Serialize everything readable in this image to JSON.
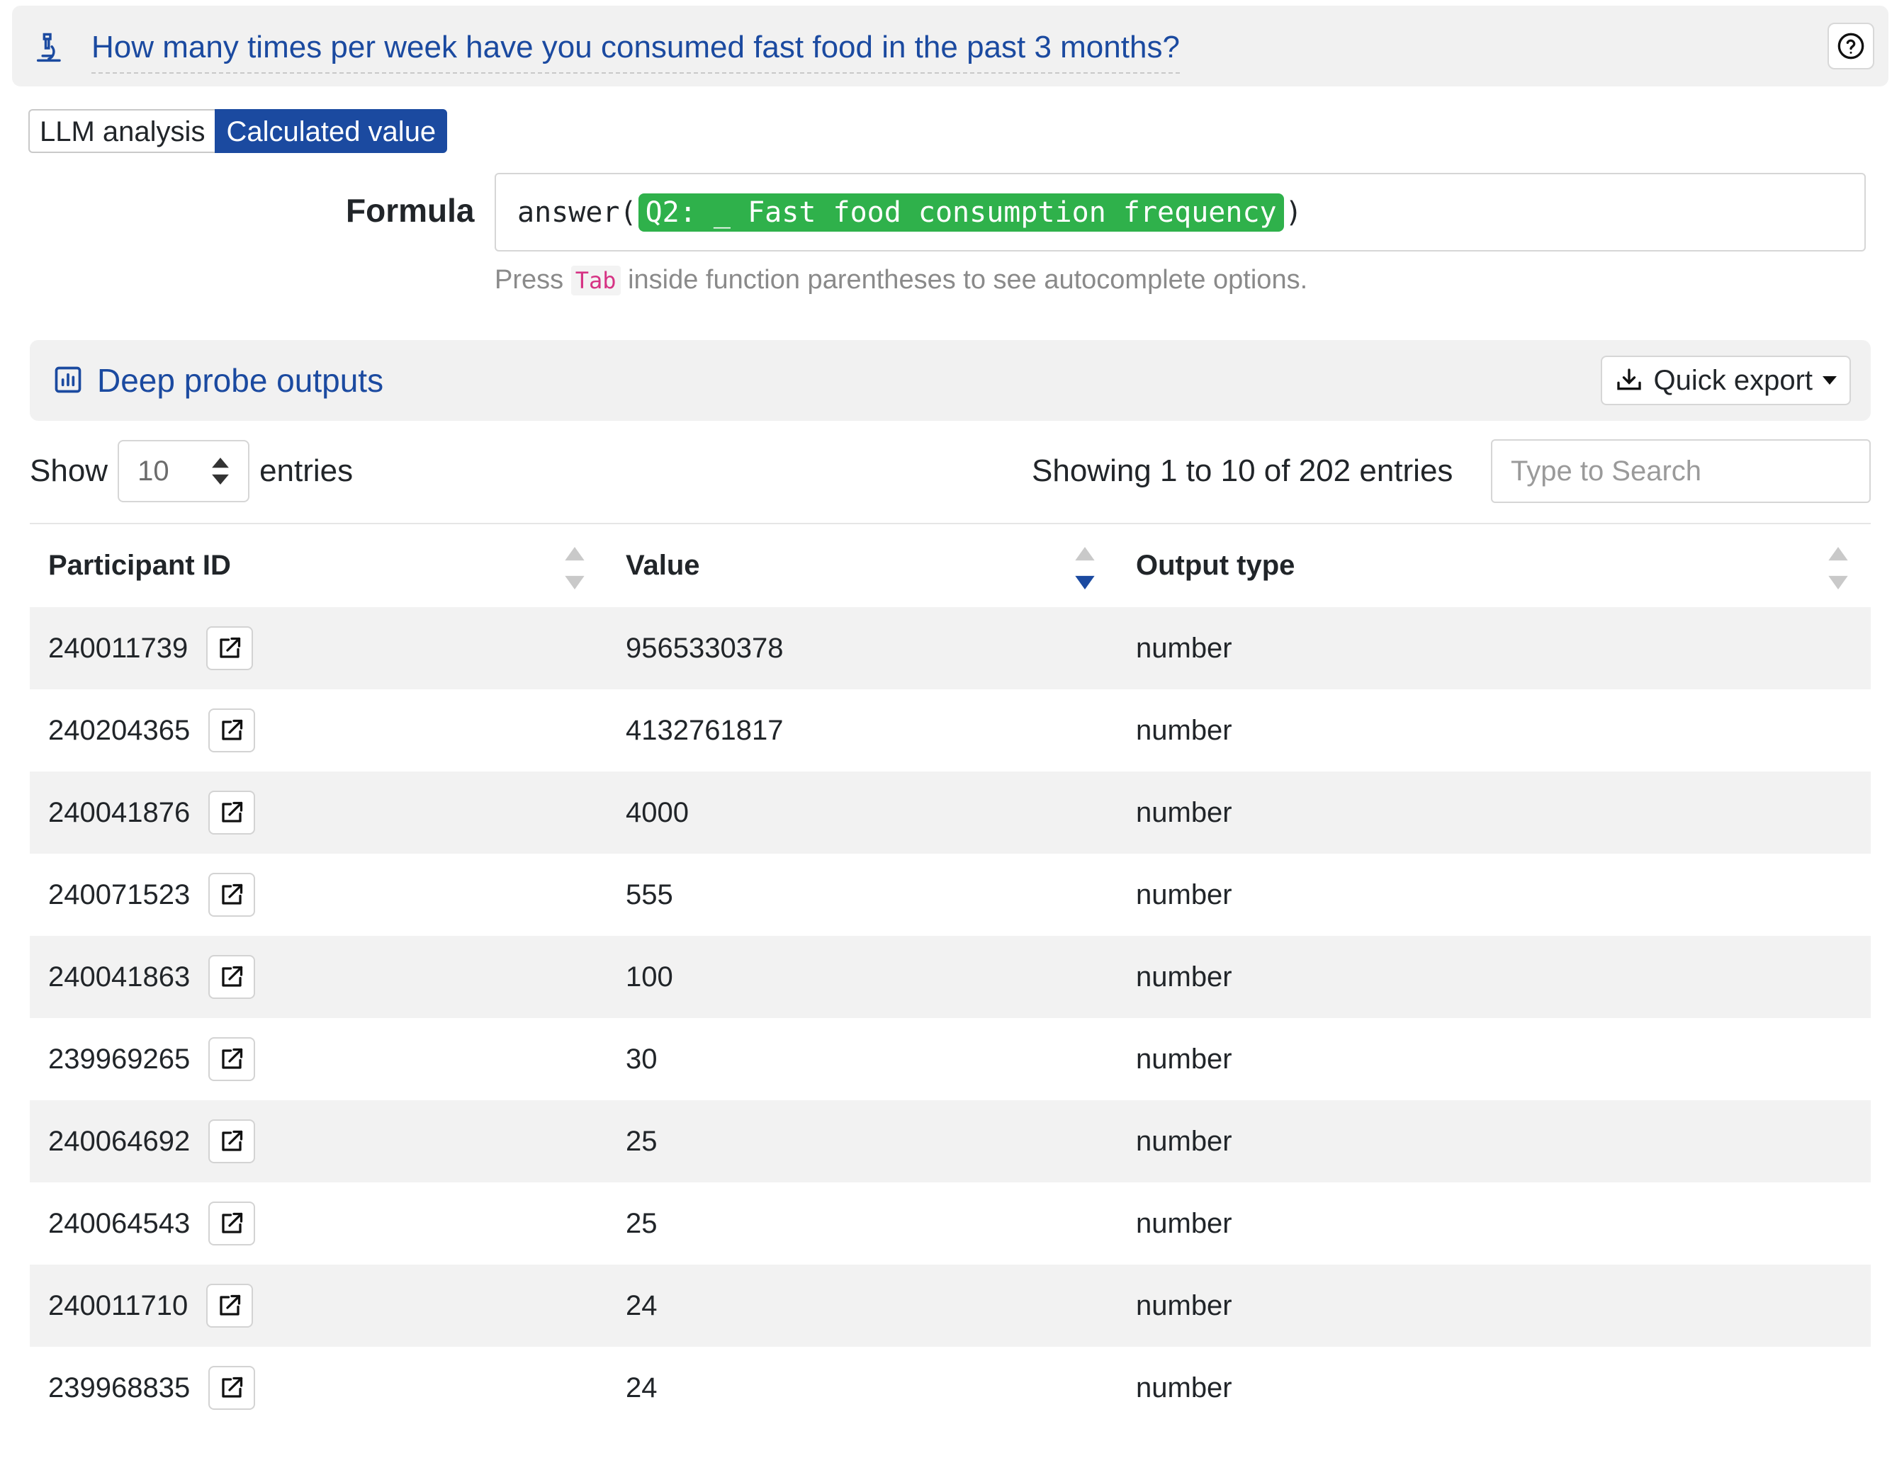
{
  "question": {
    "title": "How many times per week have you consumed fast food in the past 3 months?",
    "icon": "microscope-icon",
    "help_icon": "question-circle-icon"
  },
  "mode_toggle": {
    "options": [
      "LLM analysis",
      "Calculated value"
    ],
    "active": "Calculated value"
  },
  "formula": {
    "label": "Formula",
    "function": "answer(",
    "token": "Q2: _ Fast food consumption frequency",
    "close": ")",
    "hint_prefix": "Press",
    "hint_key": "Tab",
    "hint_suffix": "inside function parentheses to see autocomplete options."
  },
  "outputs": {
    "title": "Deep probe outputs",
    "icon": "bar-chart-icon",
    "export_label": "Quick export"
  },
  "controls": {
    "show_label": "Show",
    "page_size": "10",
    "entries_label": "entries",
    "info": "Showing 1 to 10 of 202 entries",
    "search_placeholder": "Type to Search"
  },
  "table": {
    "columns": [
      "Participant ID",
      "Value",
      "Output type"
    ],
    "sorted_column": "Value",
    "sort_direction": "desc",
    "rows": [
      {
        "id": "240011739",
        "value": "9565330378",
        "type": "number"
      },
      {
        "id": "240204365",
        "value": "4132761817",
        "type": "number"
      },
      {
        "id": "240041876",
        "value": "4000",
        "type": "number"
      },
      {
        "id": "240071523",
        "value": "555",
        "type": "number"
      },
      {
        "id": "240041863",
        "value": "100",
        "type": "number"
      },
      {
        "id": "239969265",
        "value": "30",
        "type": "number"
      },
      {
        "id": "240064692",
        "value": "25",
        "type": "number"
      },
      {
        "id": "240064543",
        "value": "25",
        "type": "number"
      },
      {
        "id": "240011710",
        "value": "24",
        "type": "number"
      },
      {
        "id": "239968835",
        "value": "24",
        "type": "number"
      }
    ]
  },
  "colors": {
    "accent": "#1b4aa0",
    "token_green": "#2fb14b",
    "panel_bg": "#f1f1f1"
  }
}
